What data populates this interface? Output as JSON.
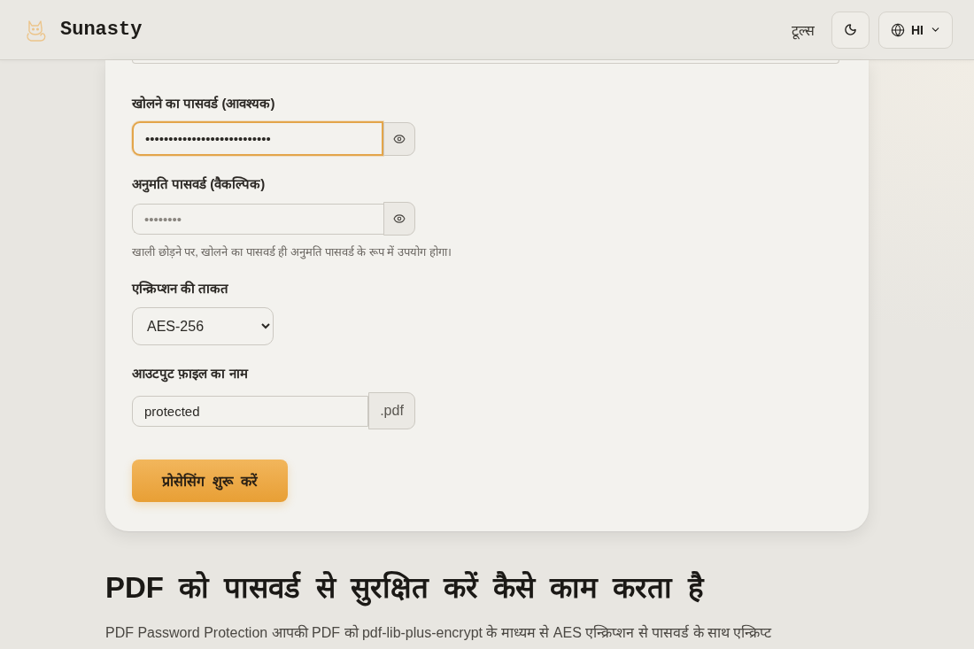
{
  "header": {
    "brand": "Sunasty",
    "nav_link": "टूल्स",
    "language": "HI"
  },
  "form": {
    "fields": [
      {
        "kind": "password",
        "label": "खोलने का पासवर्ड (आवश्यक)",
        "value": "•••••••••••••••••••••••••••",
        "focused": true
      },
      {
        "kind": "password",
        "label": "अनुमति पासवर्ड (वैकल्पिक)",
        "placeholder": "••••••••",
        "focused": false,
        "hint": "खाली छोड़ने पर, खोलने का पासवर्ड ही अनुमति पासवर्ड के रूप में उपयोग होगा।"
      },
      {
        "kind": "select",
        "label": "एन्क्रिप्शन की ताकत",
        "value": "AES-256",
        "focused": false
      },
      {
        "kind": "suffix",
        "label": "आउटपुट फ़ाइल का नाम",
        "value": "protected",
        "suffix": ".pdf",
        "focused": false
      }
    ],
    "submit": "प्रोसेसिंग शुरू करें"
  },
  "section": {
    "heading": "PDF को पासवर्ड से सुरक्षित करें कैसे काम करता है",
    "paragraph": "PDF Password Protection आपकी PDF को pdf-lib-plus-encrypt के माध्यम से AES एन्क्रिप्शन से पासवर्ड के साथ एन्क्रिप्ट"
  }
}
